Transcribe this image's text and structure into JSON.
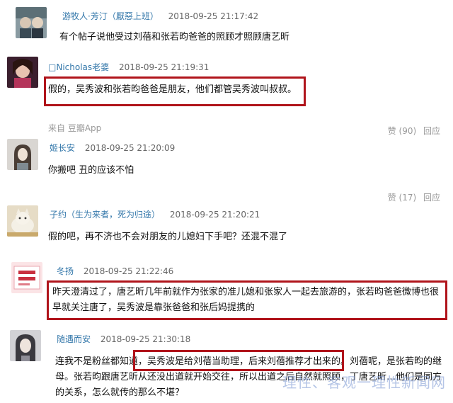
{
  "comments": [
    {
      "author": "游牧人·芳汀（厭惡上班）",
      "time": "2018-09-25 21:17:42",
      "text": "有个帖子说他受过刘蓓和张若昀爸爸的照顾才照顾唐艺昕"
    },
    {
      "author": "□Nicholas老婆",
      "time": "2018-09-25 21:19:31",
      "text": "假的，吴秀波和张若昀爸爸是朋友，他们都管吴秀波叫叔叔。",
      "source": "来自 豆瓣App",
      "likes": "赞 (90)",
      "reply": "回应"
    },
    {
      "author": "姬长安",
      "time": "2018-09-25 21:20:09",
      "text": "你搬吧 丑的应该不怕",
      "likes": "赞 (17)",
      "reply": "回应"
    },
    {
      "author": "子约（生为来者，死为归途）",
      "time": "2018-09-25 21:20:21",
      "text": "假的吧，再不济也不会对朋友的儿媳妇下手吧？还混不混了"
    },
    {
      "author": "冬扬",
      "time": "2018-09-25 21:22:46",
      "text": "昨天澄清过了，唐艺昕几年前就作为张家的准儿媳和张家人一起去旅游的，张若昀爸爸微博也很早就关注唐了，吴秀波是靠张爸爸和张后妈提携的"
    },
    {
      "author": "随遇而安",
      "time": "2018-09-25 21:30:18",
      "text": "连我不是粉丝都知道，吴秀波是给刘蓓当助理，后来刘蓓推荐才出来的。刘蓓呢，是张若昀的继母。张若昀跟唐艺昕从还没出道就开始交往，所以出道之后自然就照顾，丁唐艺昕…他们是同方的关系，怎么就传的那么不堪？"
    }
  ],
  "watermark": "理性、客观一理性新闻网",
  "colors": {
    "author": "#3377aa",
    "highlight": "#b0141b"
  }
}
